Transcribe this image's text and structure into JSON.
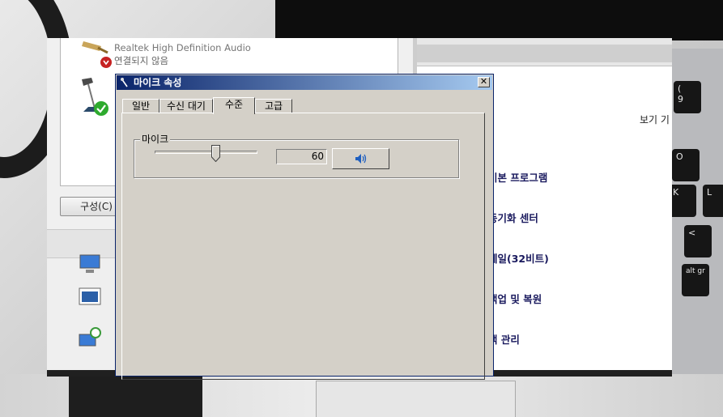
{
  "sound_dialog": {
    "device_name": "Realtek High Definition Audio",
    "device_status": "연결되지 않음",
    "config_button": "구성(C)"
  },
  "control_panel": {
    "view_label": "보기 기",
    "items": [
      {
        "label": "기본 프로그램",
        "color": "#2e9a2e"
      },
      {
        "label": "동기화 센터",
        "color": "#3aa83a"
      },
      {
        "label": "메일(32비트)",
        "color": "#2a78c8"
      },
      {
        "label": "백업 및 복원",
        "color": "#5b8f3a"
      },
      {
        "label": "색 관리",
        "color": "#4a6fc4"
      }
    ]
  },
  "mic_dialog": {
    "title": "마이크 속성",
    "close_glyph": "✕",
    "tabs": [
      {
        "label": "일반"
      },
      {
        "label": "수신 대기"
      },
      {
        "label": "수준"
      },
      {
        "label": "고급"
      }
    ],
    "active_tab": "수준",
    "group_label": "마이크",
    "level_value": "60",
    "slider_fraction": 0.6
  },
  "keyboard_keys": [
    "9",
    "(",
    "O",
    "K",
    "L",
    "<",
    "alt gr"
  ],
  "colors": {
    "titlebar_start": "#0a246a",
    "titlebar_end": "#a6caf0",
    "dialog_face": "#d4d0c8",
    "cp_text": "#1a1a5e"
  }
}
